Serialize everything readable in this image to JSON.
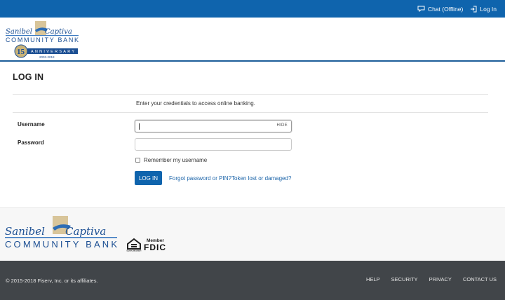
{
  "topbar": {
    "chat_label": "Chat (Offline)",
    "login_label": "Log In"
  },
  "header": {
    "logo": {
      "script_line1": "Sanibel",
      "script_line2": "Captiva",
      "name": "COMMUNITY BANK",
      "anniversary_number": "15",
      "anniversary_label": "ANNIVERSARY",
      "years": "2003-2018"
    }
  },
  "main": {
    "title": "LOG IN",
    "intro": "Enter your credentials to access online banking.",
    "username_label": "Username",
    "hide_label": "HIDE",
    "password_label": "Password",
    "remember_label": "Remember my username",
    "login_button": "LOG IN",
    "forgot_link": "Forgot password or PIN?",
    "token_link": "Token lost or damaged?"
  },
  "footer_logo": {
    "script_line1": "Sanibel",
    "script_line2": "Captiva",
    "name": "COMMUNITY BANK",
    "ehl_text": "EQUAL HOUSING LENDER",
    "fdic_member": "Member",
    "fdic": "FDIC"
  },
  "footer": {
    "copyright": "© 2015-2018 Fiserv, Inc. or its affiliates.",
    "nav": [
      "HELP",
      "SECURITY",
      "PRIVACY",
      "CONTACT US"
    ]
  },
  "colors": {
    "brand_blue": "#0f64ad",
    "footer_bg": "#414549",
    "link": "#1a63a8"
  }
}
